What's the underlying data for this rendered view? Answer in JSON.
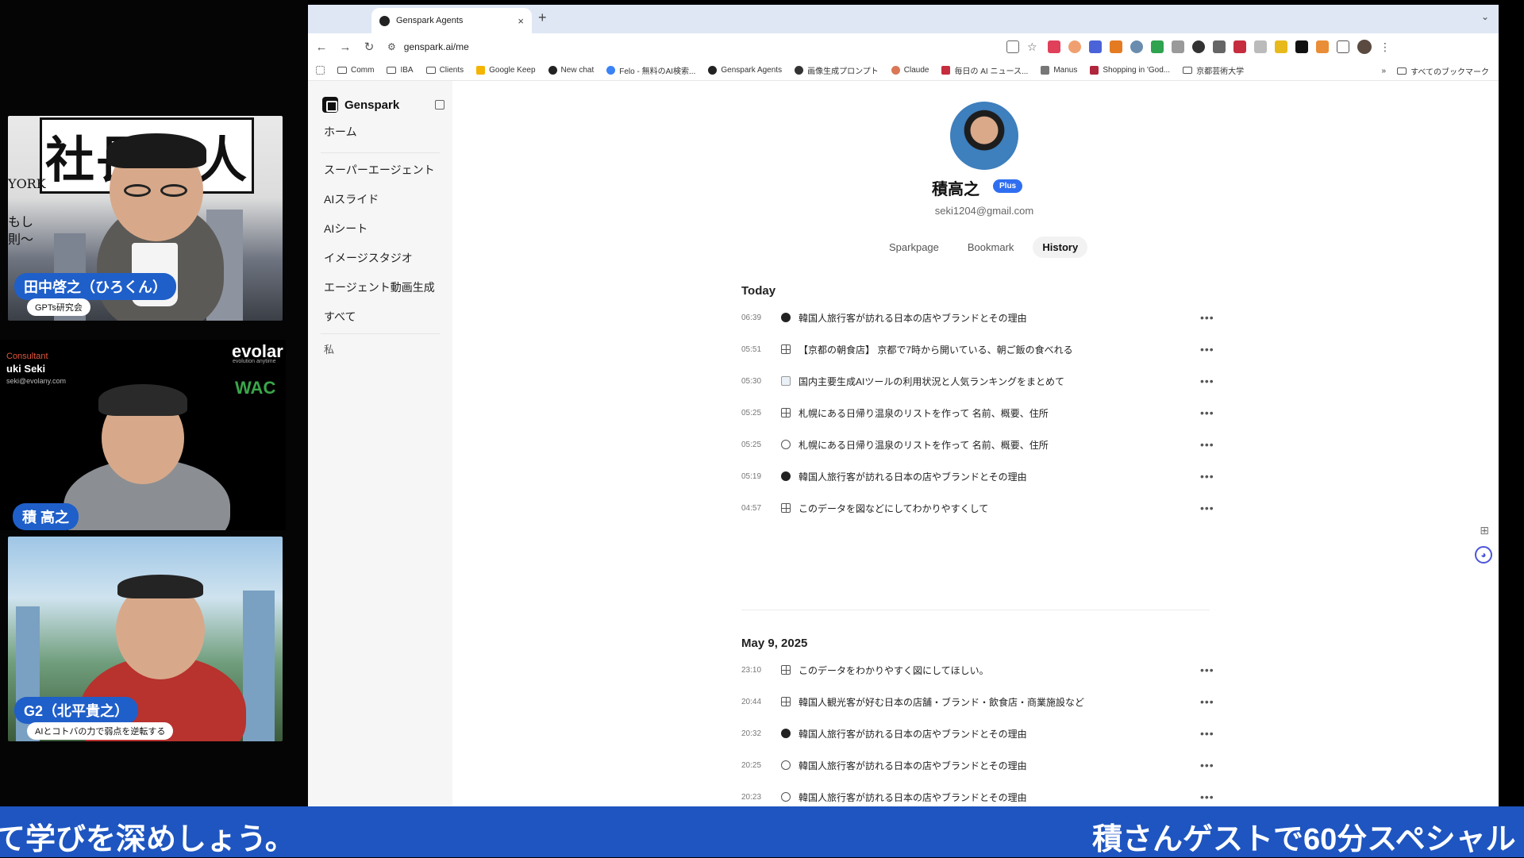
{
  "participants": {
    "tanaka": {
      "banner": "社長無人",
      "side_left_1": "YORK",
      "side_left_2": "もし",
      "side_left_3": "則〜",
      "name": "田中啓之（ひろくん）",
      "role": "GPTs研究会"
    },
    "seki": {
      "consultant_label": "Consultant",
      "card_name": "uki Seki",
      "card_email": "seki@evolany.com",
      "company": "evolar",
      "company_tagline": "evolution anytime",
      "wac": "WAC",
      "name": "積 高之"
    },
    "kitahira": {
      "name": "G2（北平貴之）",
      "tagline": "AIとコトバの力で弱点を逆転する"
    }
  },
  "browser": {
    "tab_title": "Genspark Agents",
    "tab_close": "×",
    "new_tab": "+",
    "tab_menu": "⌄",
    "url": "genspark.ai/me",
    "bookmarks": [
      "Comm",
      "IBA",
      "Clients",
      "Google Keep",
      "New chat",
      "Felo - 無料のAI検索...",
      "Genspark Agents",
      "画像生成プロンプト",
      "Claude",
      "毎日の AI ニュース...",
      "Manus",
      "Shopping in 'God...",
      "京都芸術大学"
    ],
    "bookmarks_more": "»",
    "all_bookmarks": "すべてのブックマーク"
  },
  "sidebar": {
    "brand": "Genspark",
    "items": [
      "ホーム",
      "スーパーエージェント",
      "AIスライド",
      "AIシート",
      "イメージスタジオ",
      "エージェント動画生成",
      "すべて"
    ],
    "me": "私"
  },
  "profile": {
    "name": "積高之",
    "badge": "Plus",
    "email": "seki1204@gmail.com",
    "tabs": [
      "Sparkpage",
      "Bookmark",
      "History"
    ],
    "active_tab": "History"
  },
  "history": {
    "today_label": "Today",
    "today": [
      {
        "time": "06:39",
        "icon": "agent",
        "title": "韓国人旅行客が訪れる日本の店やブランドとその理由"
      },
      {
        "time": "05:51",
        "icon": "sheet",
        "title": "【京都の朝食店】 京都で7時から開いている、朝ご飯の食べれる"
      },
      {
        "time": "05:30",
        "icon": "image",
        "title": "国内主要生成AIツールの利用状況と人気ランキングをまとめて"
      },
      {
        "time": "05:25",
        "icon": "sheet",
        "title": "札幌にある日帰り温泉のリストを作って 名前、概要、住所"
      },
      {
        "time": "05:25",
        "icon": "search",
        "title": "札幌にある日帰り温泉のリストを作って 名前、概要、住所"
      },
      {
        "time": "05:19",
        "icon": "agent",
        "title": "韓国人旅行客が訪れる日本の店やブランドとその理由"
      },
      {
        "time": "04:57",
        "icon": "sheet",
        "title": "このデータを図などにしてわかりやすくして"
      }
    ],
    "date_label": "May 9, 2025",
    "date_items": [
      {
        "time": "23:10",
        "icon": "sheet",
        "title": "このデータをわかりやすく図にしてほしい。"
      },
      {
        "time": "20:44",
        "icon": "sheet",
        "title": "韓国人観光客が好む日本の店舗・ブランド・飲食店・商業施設など"
      },
      {
        "time": "20:32",
        "icon": "agent",
        "title": "韓国人旅行客が訪れる日本の店やブランドとその理由"
      },
      {
        "time": "20:25",
        "icon": "search",
        "title": "韓国人旅行客が訪れる日本の店やブランドとその理由"
      },
      {
        "time": "20:23",
        "icon": "search",
        "title": "韓国人旅行客が訪れる日本の店やブランドとその理由"
      }
    ],
    "more": "•••"
  },
  "ticker": {
    "left": "て学びを深めしょう。",
    "right": "積さんゲストで60分スペシャル"
  }
}
